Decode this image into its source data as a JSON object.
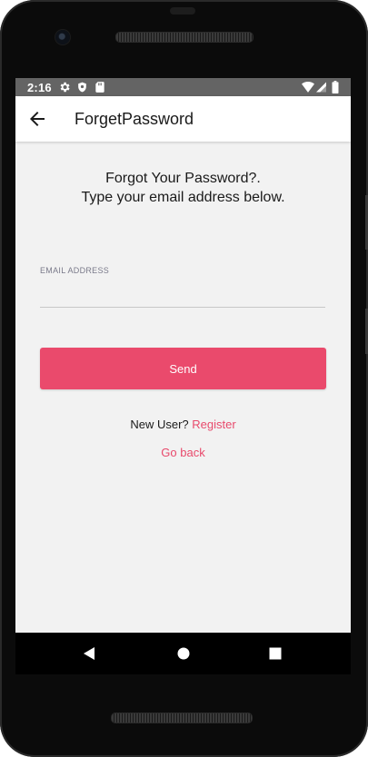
{
  "status_bar": {
    "time": "2:16",
    "left_icons": [
      "gear-icon",
      "shield-icon",
      "sd-card-icon"
    ],
    "right_icons": [
      "wifi-icon",
      "signal-icon",
      "battery-icon"
    ]
  },
  "app_bar": {
    "title": "ForgetPassword",
    "back_icon": "arrow-back-icon"
  },
  "main": {
    "heading_line1": "Forgot Your Password?.",
    "heading_line2": "Type your email address below.",
    "email_label": "EMAIL ADDRESS",
    "email_value": "",
    "send_label": "Send",
    "new_user_text": "New User?",
    "register_label": "Register",
    "go_back_label": "Go back"
  },
  "nav_bar": {
    "icons": [
      "back-triangle-icon",
      "home-circle-icon",
      "recents-square-icon"
    ]
  },
  "colors": {
    "accent": "#ea4a6c",
    "status_bar": "#646464",
    "background": "#f2f2f2"
  }
}
